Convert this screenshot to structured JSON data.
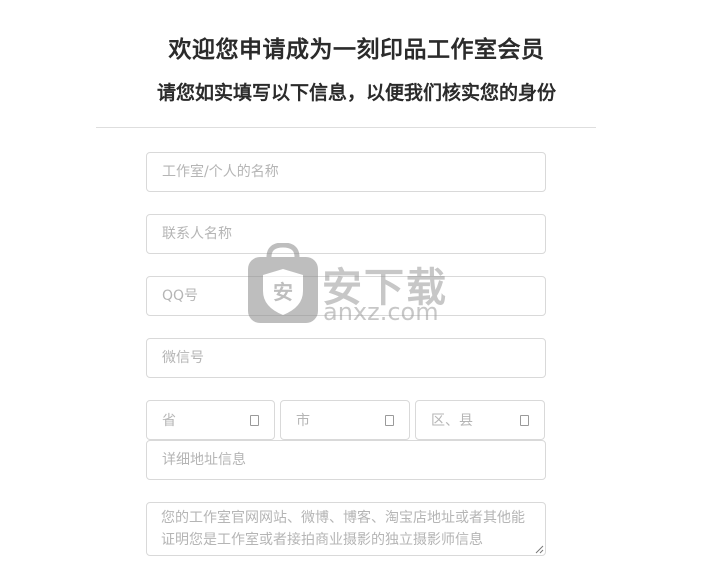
{
  "header": {
    "title": "欢迎您申请成为一刻印品工作室会员",
    "subtitle": "请您如实填写以下信息，以便我们核实您的身份"
  },
  "form": {
    "studio_name_placeholder": "工作室/个人的名称",
    "contact_name_placeholder": "联系人名称",
    "qq_placeholder": "QQ号",
    "wechat_placeholder": "微信号",
    "province_label": "省",
    "city_label": "市",
    "district_label": "区、县",
    "address_placeholder": "详细地址信息",
    "proof_placeholder": "您的工作室官网网站、微博、博客、淘宝店地址或者其他能证明您是工作室或者接拍商业摄影的独立摄影师信息"
  },
  "watermark": {
    "brand_cn": "安下载",
    "brand_en": "anxz.com"
  }
}
